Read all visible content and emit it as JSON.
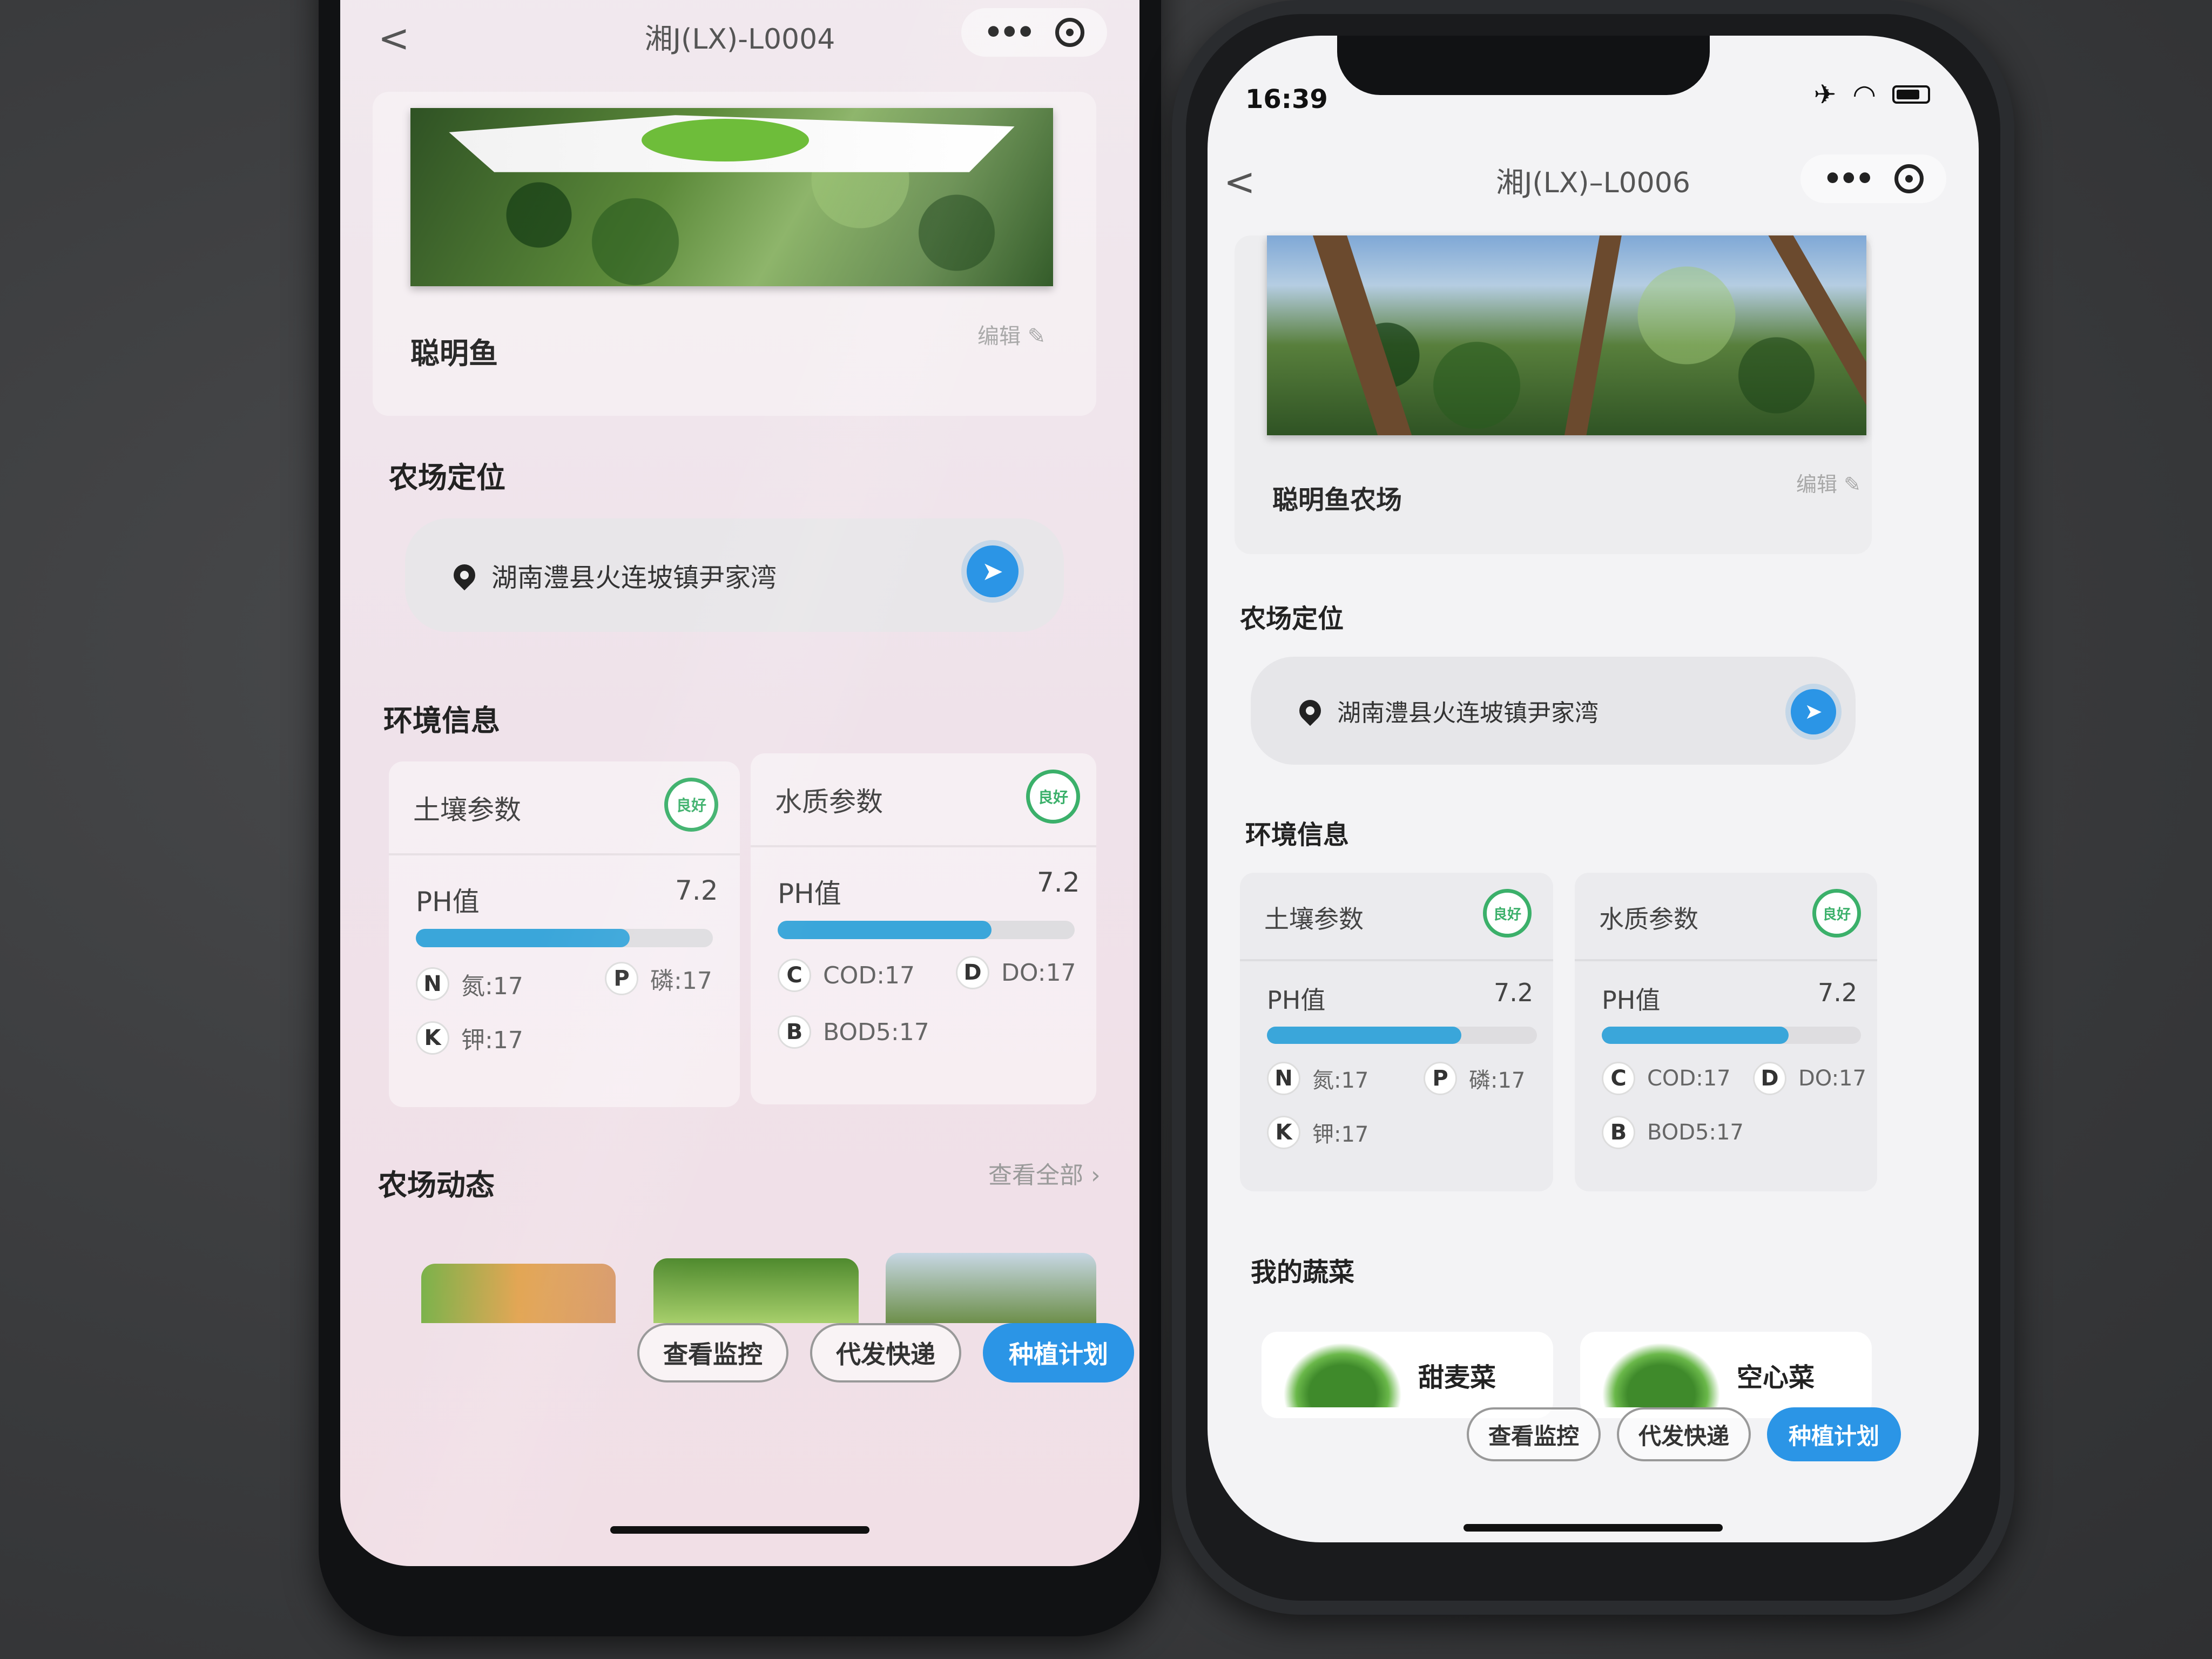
{
  "left_phone": {
    "nav": {
      "back_glyph": "<",
      "title": "湘J(LX)-L0004"
    },
    "farm_name": "聪明鱼",
    "edit": "编辑",
    "location_title": "农场定位",
    "location_text": "湖南澧县火连坡镇尹家湾",
    "env_title": "环境信息",
    "soil": {
      "title": "土壤参数",
      "badge": "良好",
      "ph_label": "PH值",
      "ph_value": "7.2",
      "ph_fill": 0.72,
      "chips": [
        {
          "letter": "N",
          "text": "氮:17"
        },
        {
          "letter": "P",
          "text": "磷:17"
        },
        {
          "letter": "K",
          "text": "钾:17"
        }
      ]
    },
    "water": {
      "title": "水质参数",
      "badge": "良好",
      "ph_label": "PH值",
      "ph_value": "7.2",
      "ph_fill": 0.72,
      "chips": [
        {
          "letter": "C",
          "text": "COD:17"
        },
        {
          "letter": "D",
          "text": "DO:17"
        },
        {
          "letter": "B",
          "text": "BOD5:17"
        }
      ]
    },
    "dynamics_title": "农场动态",
    "view_all": "查看全部",
    "actions": {
      "monitor": "查看监控",
      "express": "代发快递",
      "plan": "种植计划"
    }
  },
  "right_phone": {
    "status_time": "16:39",
    "nav": {
      "back_glyph": "<",
      "title": "湘J(LX)–L0006"
    },
    "farm_name": "聪明鱼农场",
    "edit": "编辑",
    "location_title": "农场定位",
    "location_text": "湖南澧县火连坡镇尹家湾",
    "env_title": "环境信息",
    "soil": {
      "title": "土壤参数",
      "badge": "良好",
      "ph_label": "PH值",
      "ph_value": "7.2",
      "ph_fill": 0.72,
      "chips": [
        {
          "letter": "N",
          "text": "氮:17"
        },
        {
          "letter": "P",
          "text": "磷:17"
        },
        {
          "letter": "K",
          "text": "钾:17"
        }
      ]
    },
    "water": {
      "title": "水质参数",
      "badge": "良好",
      "ph_label": "PH值",
      "ph_value": "7.2",
      "ph_fill": 0.72,
      "chips": [
        {
          "letter": "C",
          "text": "COD:17"
        },
        {
          "letter": "D",
          "text": "DO:17"
        },
        {
          "letter": "B",
          "text": "BOD5:17"
        }
      ]
    },
    "veg_title": "我的蔬菜",
    "vegetables": [
      "甜麦菜",
      "空心菜"
    ],
    "actions": {
      "monitor": "查看监控",
      "express": "代发快递",
      "plan": "种植计划"
    }
  },
  "colors": {
    "accent": "#2b95e6",
    "good": "#3bb06a",
    "bar": "#3aa6da"
  },
  "icons": [
    "back-icon",
    "more-icon",
    "close-icon",
    "location-pin-icon",
    "navigate-arrow-icon",
    "edit-pencil-icon",
    "airplane-icon",
    "wifi-icon",
    "battery-icon"
  ]
}
